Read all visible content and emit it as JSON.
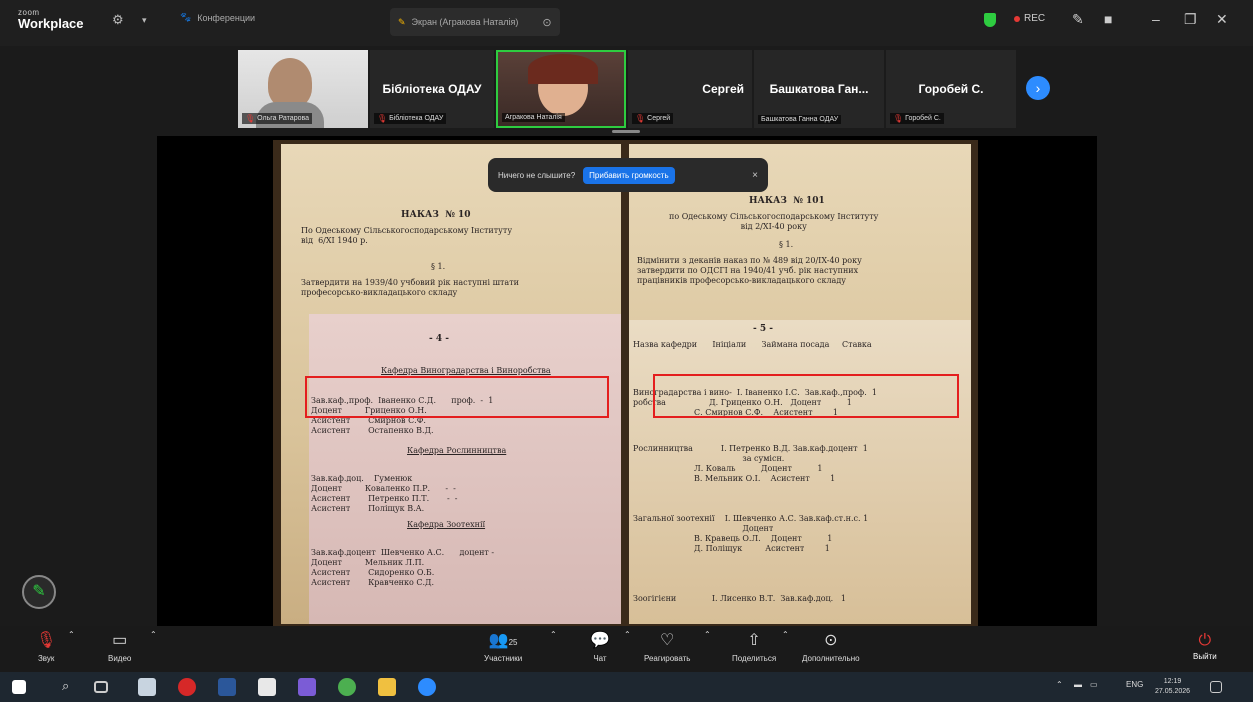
{
  "app": {
    "logo_small": "zoom",
    "logo_big": "Workplace"
  },
  "titlebar": {
    "tab_meeting": "Конференции",
    "tab_share": "Экран (Агракова Наталія)",
    "rec_label": "REC"
  },
  "participants": [
    {
      "name_big": "",
      "label": "Ольга Ратарова",
      "has_video": true
    },
    {
      "name_big": "Бібліотека ОДАУ",
      "label": "Бібліотека ОДАУ",
      "has_video": false
    },
    {
      "name_big": "",
      "label": "Агракова Наталія",
      "has_video": true,
      "active": true
    },
    {
      "name_big": "Сергей",
      "label": "Сергей",
      "has_video": false
    },
    {
      "name_big": "Башкатова Ган...",
      "label": "Башкатова Ганна ОДАУ",
      "has_video": false
    },
    {
      "name_big": "Горобей С.",
      "label": "Горобей С.",
      "has_video": false
    }
  ],
  "notice": {
    "text": "Ничего не слышите?",
    "button": "Прибавить громкость",
    "close": "×"
  },
  "document": {
    "left_header": "НАКАЗ  № 10",
    "left_sub": "По Одеському Сільськогосподарському Інституту\nвід  6/XI 1940 р.",
    "left_section": "§ 1.",
    "left_para": "Затвердити на 1939/40 учбовий рік наступні штати\nпрофесорсько-викладацького складу",
    "left_page_num": "- 4 -",
    "left_kafedra1": "Кафедра Виноградарства і Виноробства",
    "left_kafedra2": "Кафедра Рослинництва",
    "left_kafedra3": "Кафедра Зоотехнії",
    "right_header": "НАКАЗ  № 101",
    "right_sub": "по Одеському Сільськогосподарському Інституту\nвід 2/XI-40 року",
    "right_section": "§ 1.",
    "right_para": "Відмінити з деканів наказ по № 489 від 20/IX-40 року\nзатвердити по ОДСГІ на 1940/41 учб. рік наступних\nпрацівників професорсько-викладацького складу",
    "right_cols": "Назва кафедри      Ініціали      Займана посада     Ставка",
    "right_page_num": "- 5 -"
  },
  "toolbar": {
    "audio": "Звук",
    "video": "Видео",
    "participants": "Участники",
    "participants_count": "25",
    "chat": "Чат",
    "react": "Реагировать",
    "share": "Поделиться",
    "more": "Дополнительно",
    "leave": "Выйти"
  },
  "taskbar": {
    "lang": "ENG",
    "time": "12:19",
    "date": "27.05.2026"
  }
}
